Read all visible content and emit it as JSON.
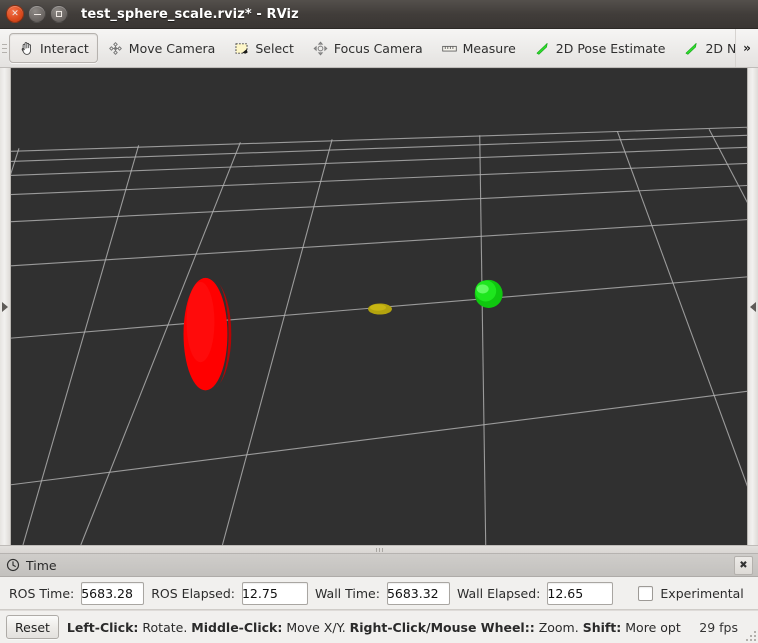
{
  "window": {
    "title": "test_sphere_scale.rviz* - RViz",
    "buttons": {
      "close": "×",
      "minimize": "minimize-icon",
      "maximize": "maximize-icon"
    }
  },
  "toolbar": {
    "items": [
      {
        "label": "Interact",
        "icon": "hand-cursor-icon",
        "active": true
      },
      {
        "label": "Move Camera",
        "icon": "move-camera-icon",
        "active": false
      },
      {
        "label": "Select",
        "icon": "select-rectangle-icon",
        "active": false
      },
      {
        "label": "Focus Camera",
        "icon": "focus-camera-icon",
        "active": false
      },
      {
        "label": "Measure",
        "icon": "ruler-icon",
        "active": false
      },
      {
        "label": "2D Pose Estimate",
        "icon": "green-arrow-icon",
        "active": false
      },
      {
        "label": "2D Nav Goal",
        "icon": "green-arrow-icon",
        "active": false
      }
    ],
    "overflow_label": "»"
  },
  "viewport": {
    "background_color": "#303030",
    "grid_color": "#b4b4b4",
    "left_handle_icon": "expand-right-triangle-icon",
    "right_handle_icon": "expand-left-triangle-icon",
    "objects": [
      {
        "name": "red-ellipsoid",
        "color": "#ff0000",
        "shade": "#b00000"
      },
      {
        "name": "yellow-ellipsoid",
        "color": "#b8a80f",
        "shade": "#8d8008"
      },
      {
        "name": "green-sphere",
        "color": "#14d414",
        "shade": "#0a9c0a",
        "highlight": "#7dff7d"
      }
    ]
  },
  "time_panel": {
    "title": "Time",
    "title_icon": "clock-icon",
    "close_label": "✖",
    "fields": [
      {
        "label": "ROS Time:",
        "value": "5683.28"
      },
      {
        "label": "ROS Elapsed:",
        "value": "12.75"
      },
      {
        "label": "Wall Time:",
        "value": "5683.32"
      },
      {
        "label": "Wall Elapsed:",
        "value": "12.65"
      }
    ],
    "experimental": {
      "label": "Experimental",
      "checked": false
    }
  },
  "status_bar": {
    "reset_label": "Reset",
    "hints": [
      {
        "key": "Left-Click:",
        "text": " Rotate. "
      },
      {
        "key": "Middle-Click:",
        "text": " Move X/Y. "
      },
      {
        "key": "Right-Click/Mouse Wheel::",
        "text": " Zoom. "
      },
      {
        "key": "Shift:",
        "text": " More opt"
      }
    ],
    "fps": "29 fps"
  }
}
